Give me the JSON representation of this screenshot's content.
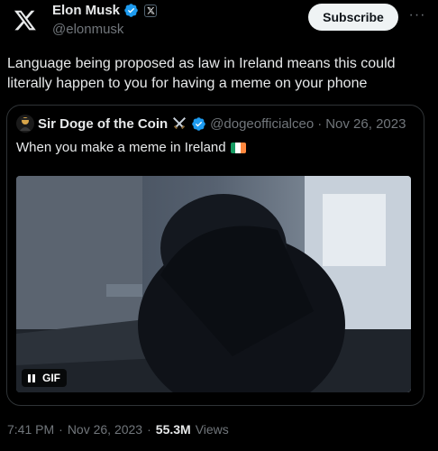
{
  "author": {
    "name": "Elon Musk",
    "handle": "@elonmusk",
    "logo_icon": "x-logo-icon",
    "affiliation_icon": "x-affiliate-badge-icon"
  },
  "actions": {
    "subscribe_label": "Subscribe",
    "more_label": "···"
  },
  "post": {
    "text": "Language being proposed as law in Ireland means this could literally happen to you for having a meme on your phone",
    "time": "7:41 PM",
    "date": "Nov 26, 2023",
    "views_count": "55.3M",
    "views_label": "Views",
    "separator": "·"
  },
  "quoted": {
    "name": "Sir Doge of the Coin",
    "handle": "@dogeofficialceo",
    "separator": "·",
    "date": "Nov 26, 2023",
    "text": "When you make a meme in Ireland",
    "media_badge": "GIF"
  },
  "colors": {
    "verified_blue": "#1d9bf0",
    "flag_green": "#169b62",
    "flag_white": "#ffffff",
    "flag_orange": "#ff883e"
  }
}
